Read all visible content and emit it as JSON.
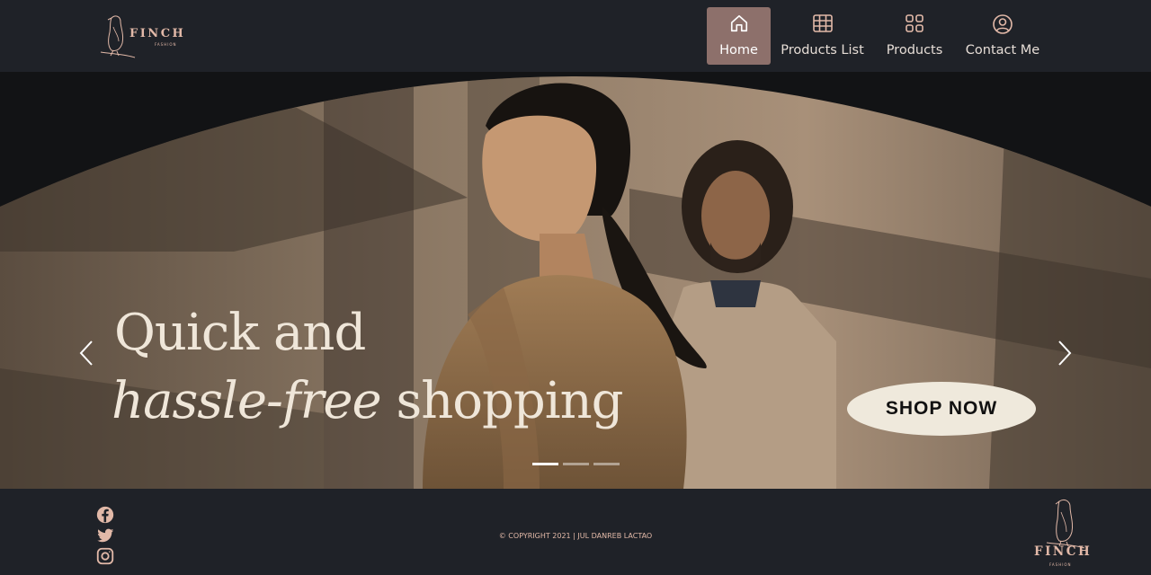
{
  "brand": {
    "name": "FINCH",
    "tagline": "FASHION"
  },
  "nav": {
    "items": [
      {
        "label": "Home",
        "icon": "home-icon",
        "active": true
      },
      {
        "label": "Products List",
        "icon": "table-icon",
        "active": false
      },
      {
        "label": "Products",
        "icon": "grid-icon",
        "active": false
      },
      {
        "label": "Contact Me",
        "icon": "user-circle-icon",
        "active": false
      }
    ]
  },
  "hero": {
    "headline_line1": "Quick and",
    "headline_italic": "hassle-free",
    "headline_rest": " shopping",
    "cta_label": "SHOP NOW",
    "slides": 3,
    "active_slide": 1
  },
  "footer": {
    "social": [
      "facebook-icon",
      "twitter-icon",
      "instagram-icon"
    ],
    "copyright": "© COPYRIGHT 2021 | JUL DANREB LACTAO"
  },
  "colors": {
    "background": "#1f2228",
    "accent": "#8d706b",
    "brand_pink": "#e2b9a8",
    "cta_bg": "#efe9dc"
  }
}
